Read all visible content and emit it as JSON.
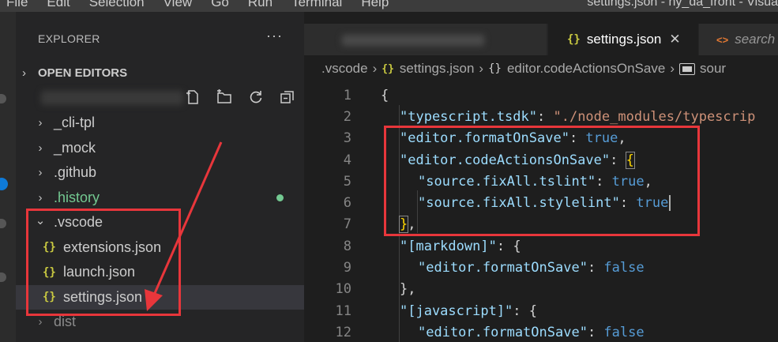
{
  "menu": [
    "File",
    "Edit",
    "Selection",
    "View",
    "Go",
    "Run",
    "Terminal",
    "Help"
  ],
  "window_title": "settings.json - hy_da_front - Visua",
  "sidebar": {
    "title": "EXPLORER",
    "more": "···",
    "open_editors": "OPEN EDITORS",
    "tree": [
      {
        "label": "_cli-tpl",
        "kind": "folder",
        "expanded": false,
        "color": "#cccccc"
      },
      {
        "label": "_mock",
        "kind": "folder",
        "expanded": false,
        "color": "#cccccc"
      },
      {
        "label": ".github",
        "kind": "folder",
        "expanded": false,
        "color": "#cccccc"
      },
      {
        "label": ".history",
        "kind": "folder",
        "expanded": false,
        "color": "#73c991"
      },
      {
        "label": ".vscode",
        "kind": "folder",
        "expanded": true,
        "color": "#cccccc"
      },
      {
        "label": "extensions.json",
        "kind": "json",
        "color": "#cccccc"
      },
      {
        "label": "launch.json",
        "kind": "json",
        "color": "#cccccc"
      },
      {
        "label": "settings.json",
        "kind": "json",
        "selected": true,
        "color": "#cccccc"
      },
      {
        "label": "dist",
        "kind": "folder",
        "expanded": false,
        "color": "#8c8c8c"
      }
    ],
    "json_icon": "{}",
    "chevron_right": "›",
    "chevron_down": "⌄"
  },
  "tabs": {
    "active_label": "settings.json",
    "active_icon": "{}",
    "close": "✕",
    "inactive_label": "search",
    "inactive_icon": "<>"
  },
  "breadcrumb": {
    "folder": ".vscode",
    "file": "settings.json",
    "object": "editor.codeActionsOnSave",
    "leaf": "sour",
    "sep": "›",
    "json_icon": "{}",
    "object_icon": "{}"
  },
  "code": {
    "line_numbers": [
      "1",
      "2",
      "3",
      "4",
      "5",
      "6",
      "7",
      "8",
      "9",
      "10",
      "11",
      "12"
    ],
    "l1": "{",
    "l2_key": "\"typescript.tsdk\"",
    "l2_colon": ": ",
    "l2_val": "\"./node_modules/typescrip",
    "l3_key": "\"editor.formatOnSave\"",
    "l3_colon": ": ",
    "l3_val": "true",
    "l3_end": ",",
    "l4_key": "\"editor.codeActionsOnSave\"",
    "l4_colon": ": ",
    "l4_brace": "{",
    "l5_key": "\"source.fixAll.tslint\"",
    "l5_colon": ": ",
    "l5_val": "true",
    "l5_end": ",",
    "l6_key": "\"source.fixAll.stylelint\"",
    "l6_colon": ": ",
    "l6_val": "true",
    "l7_brace": "}",
    "l7_end": ",",
    "l8_key": "\"[markdown]\"",
    "l8_colon": ": ",
    "l8_brace": "{",
    "l9_key": "\"editor.formatOnSave\"",
    "l9_colon": ": ",
    "l9_val": "false",
    "l10": "},",
    "l11_key": "\"[javascript]\"",
    "l11_colon": ": ",
    "l11_brace": "{",
    "l12_key": "\"editor.formatOnSave\"",
    "l12_colon": ": ",
    "l12_val": "false"
  },
  "colors": {
    "annotation": "#e8363b",
    "json_icon": "#cbcb41",
    "git_untracked": "#73c991"
  }
}
